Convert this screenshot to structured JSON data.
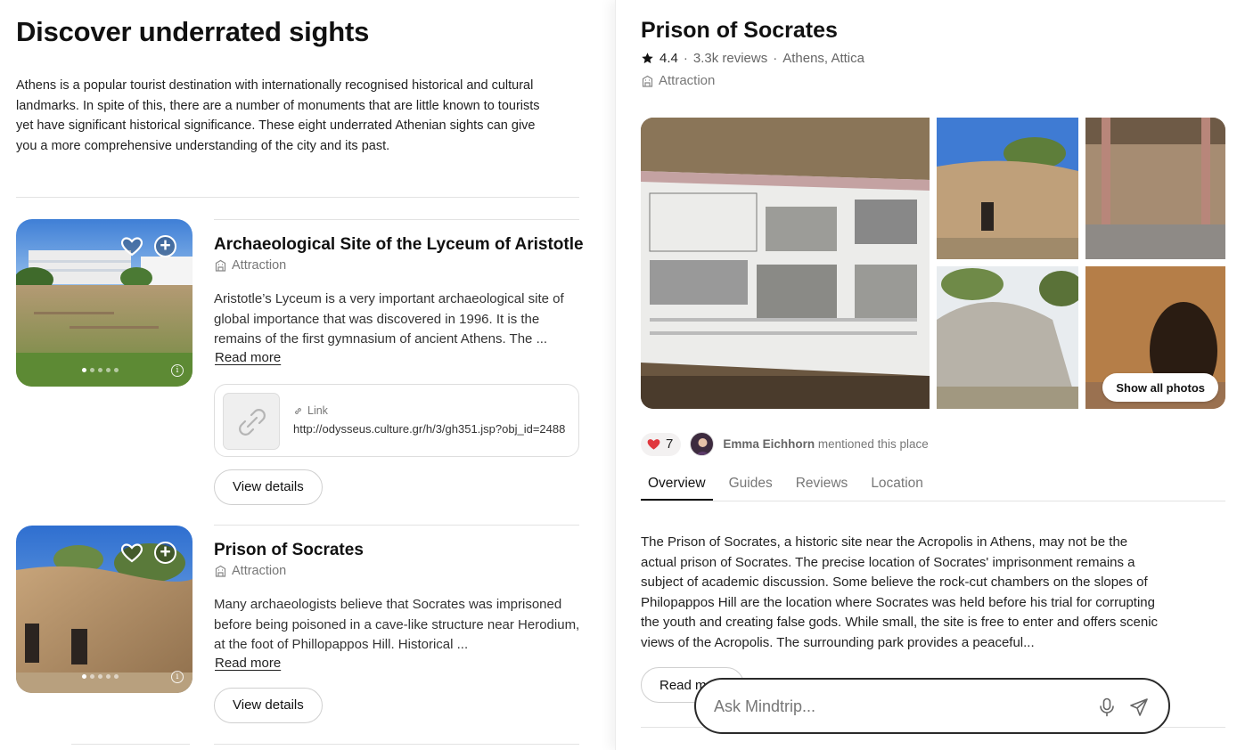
{
  "left": {
    "heading": "Discover underrated sights",
    "intro": "Athens is a popular tourist destination with internationally recognised historical and cultural landmarks. In spite of this, there are a number of monuments that are little known to tourists yet have significant historical significance. These eight underrated Athenian sights can give you a more comprehensive understanding of the city and its past.",
    "cards": [
      {
        "title": "Archaeological Site of the Lyceum of Aristotle",
        "type": "Attraction",
        "description": "Aristotle’s Lyceum is a very important archaeological site of global importance that was discovered in 1996. It is the remains of the first gymnasium of ancient Athens. The ...",
        "read_more": "Read more",
        "link_label": "Link",
        "link_url": "http://odysseus.culture.gr/h/3/gh351.jsp?obj_id=2488",
        "view_details": "View details"
      },
      {
        "title": "Prison of Socrates",
        "type": "Attraction",
        "description": "Many archaeologists believe that Socrates was imprisoned before being poisoned in a cave-like structure near Herodium, at the foot of Phillopappos Hill. Historical ...",
        "read_more": "Read more",
        "view_details": "View details"
      }
    ]
  },
  "detail": {
    "title": "Prison of Socrates",
    "rating": "4.4",
    "reviews": "3.3k reviews",
    "location": "Athens, Attica",
    "type": "Attraction",
    "show_all_photos": "Show all photos",
    "likes": "7",
    "mention_user": "Emma Eichhorn",
    "mention_text": "mentioned this place",
    "tabs": [
      "Overview",
      "Guides",
      "Reviews",
      "Location"
    ],
    "active_tab": "Overview",
    "overview": "The Prison of Socrates, a historic site near the Acropolis in Athens, may not be the actual prison of Socrates. The precise location of Socrates' imprisonment remains a subject of academic discussion. Some believe the rock-cut chambers on the slopes of Philopappos Hill are the location where Socrates was held before his trial for corrupting the youth and creating false gods. While small, the site is free to enter and offers scenic views of the Acropolis. The surrounding park provides a peaceful...",
    "read_more": "Read more"
  },
  "ask": {
    "placeholder": "Ask Mindtrip..."
  },
  "colors": {
    "accent_text": "#111111",
    "muted_text": "#777777",
    "heart_red": "#e0383e",
    "border": "#dedede"
  },
  "icons": {
    "favorite": "heart-icon",
    "add": "plus-circle-icon",
    "info": "info-icon",
    "attraction": "building-icon",
    "link": "link-icon",
    "rating": "star-icon",
    "mic": "microphone-icon",
    "send": "send-icon"
  }
}
